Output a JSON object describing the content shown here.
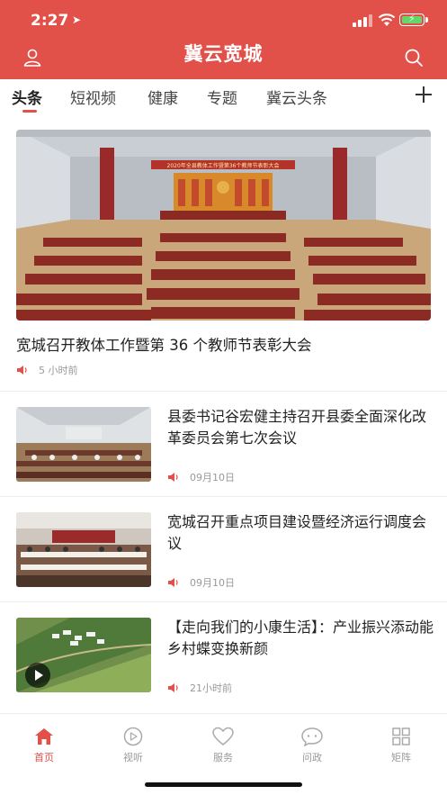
{
  "status_bar": {
    "time": "2:27",
    "location_icon": "location-arrow-icon",
    "battery_icon": "battery-charging-icon"
  },
  "header": {
    "title": "冀云宽城",
    "left_icon": "user-icon",
    "right_icon": "search-icon",
    "color": "#e2504a"
  },
  "tabs": [
    {
      "label": "头条",
      "active": true
    },
    {
      "label": "短视频"
    },
    {
      "label": "健康"
    },
    {
      "label": "专题"
    },
    {
      "label": "冀云头条"
    }
  ],
  "tabs_add_icon": "plus-icon",
  "feed": {
    "hero": {
      "title": "宽城召开教体工作暨第 36 个教师节表彰大会",
      "time": "5 小时前",
      "banner_text": "2020年全县教体工作暨第36个教师节表彰大会"
    },
    "items": [
      {
        "title": "县委书记谷宏健主持召开县委全面深化改革委员会第七次会议",
        "time": "09月10日"
      },
      {
        "title": "宽城召开重点项目建设暨经济运行调度会议",
        "time": "09月10日"
      },
      {
        "title": "【走向我们的小康生活】：产业振兴添动能 乡村蝶变换新颜",
        "time": "21小时前",
        "has_video": true
      }
    ]
  },
  "bottom_nav": [
    {
      "label": "首页",
      "icon": "home-icon",
      "active": true
    },
    {
      "label": "视听",
      "icon": "play-circle-icon"
    },
    {
      "label": "服务",
      "icon": "heart-icon"
    },
    {
      "label": "问政",
      "icon": "chat-bubble-icon"
    },
    {
      "label": "矩阵",
      "icon": "grid-icon"
    }
  ]
}
